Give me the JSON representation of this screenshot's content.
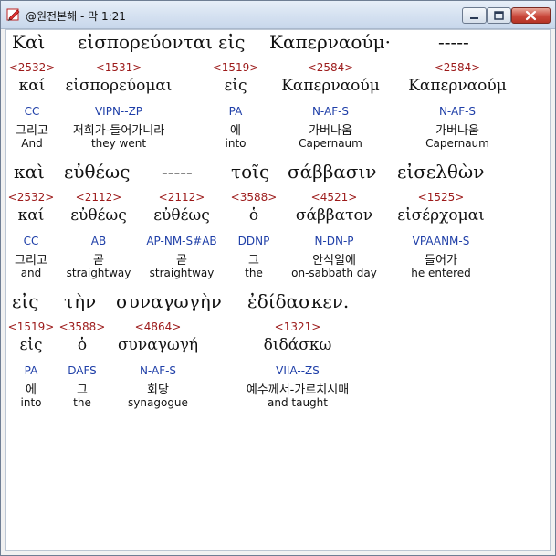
{
  "window": {
    "title": "@원전본해 - 막 1:21",
    "icon": "bible-app-icon",
    "colors": {
      "strongs": "#9c1a1a",
      "parsing": "#1f3fa8",
      "text": "#111111"
    }
  },
  "rows": [
    {
      "words": [
        {
          "greek": "Καὶ",
          "strongs": "<2532>",
          "lemma": "καί",
          "parsing": "CC",
          "korean": "그리고",
          "english": "And"
        },
        {
          "greek": "εἰσπορεύονται",
          "strongs": "<1531>",
          "lemma": "εἰσπορεύομαι",
          "parsing": "VIPN--ZP",
          "korean": "저희가-들어가니라",
          "english": "they went"
        },
        {
          "greek": "εἰς",
          "strongs": "<1519>",
          "lemma": "εἰς",
          "parsing": "PA",
          "korean": "에",
          "english": "into"
        },
        {
          "greek": "Καπερναούμ·",
          "strongs": "<2584>",
          "lemma": "Καπερναούμ",
          "parsing": "N-AF-S",
          "korean": "가버나움",
          "english": "Capernaum"
        },
        {
          "greek": "-----",
          "strongs": "<2584>",
          "lemma": "Καπερναούμ",
          "parsing": "N-AF-S",
          "korean": "가버나움",
          "english": "Capernaum"
        }
      ]
    },
    {
      "words": [
        {
          "greek": "καὶ",
          "strongs": "<2532>",
          "lemma": "καί",
          "parsing": "CC",
          "korean": "그리고",
          "english": "and"
        },
        {
          "greek": "εὐθέως",
          "strongs": "<2112>",
          "lemma": "εὐθέως",
          "parsing": "AB",
          "korean": "곧",
          "english": "straightway"
        },
        {
          "greek": "-----",
          "strongs": "<2112>",
          "lemma": "εὐθέως",
          "parsing": "AP-NM-S#AB",
          "korean": "곧",
          "english": "straightway"
        },
        {
          "greek": "τοῖς",
          "strongs": "<3588>",
          "lemma": "ὁ",
          "parsing": "DDNP",
          "korean": "그",
          "english": "the"
        },
        {
          "greek": "σάββασιν",
          "strongs": "<4521>",
          "lemma": "σάββατον",
          "parsing": "N-DN-P",
          "korean": "안식일에",
          "english": "on-sabbath day"
        },
        {
          "greek": "εἰσελθὼν",
          "strongs": "<1525>",
          "lemma": "εἰσέρχομαι",
          "parsing": "VPAANM-S",
          "korean": "들어가",
          "english": "he entered"
        }
      ]
    },
    {
      "words": [
        {
          "greek": "εἰς",
          "strongs": "<1519>",
          "lemma": "εἰς",
          "parsing": "PA",
          "korean": "에",
          "english": "into"
        },
        {
          "greek": "τὴν",
          "strongs": "<3588>",
          "lemma": "ὁ",
          "parsing": "DAFS",
          "korean": "그",
          "english": "the"
        },
        {
          "greek": "συναγωγὴν",
          "strongs": "<4864>",
          "lemma": "συναγωγή",
          "parsing": "N-AF-S",
          "korean": "회당",
          "english": "synagogue"
        },
        {
          "greek": "ἐδίδασκεν.",
          "strongs": "<1321>",
          "lemma": "διδάσκω",
          "parsing": "VIIA--ZS",
          "korean": "예수께서-가르치시매",
          "english": "and taught"
        }
      ]
    }
  ]
}
